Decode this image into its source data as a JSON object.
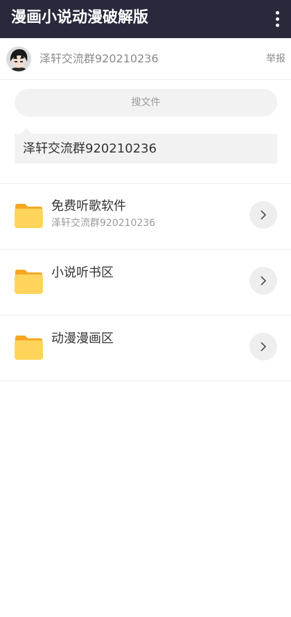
{
  "app_bar": {
    "title": "漫画小说动漫破解版",
    "menu_icon": "more-vert-icon",
    "background": "#282a3c"
  },
  "owner": {
    "name": "泽轩交流群920210236",
    "avatar_icon": "avatar-portrait",
    "report_label": "举报"
  },
  "search": {
    "label": "搜文件"
  },
  "notice": {
    "text": "泽轩交流群920210236"
  },
  "folders": [
    {
      "title": "免费听歌软件",
      "subtitle": "泽轩交流群920210236",
      "icon": "folder-icon",
      "action_icon": "chevron-right-icon"
    },
    {
      "title": "小说听书区",
      "subtitle": "",
      "icon": "folder-icon",
      "action_icon": "chevron-right-icon"
    },
    {
      "title": "动漫漫画区",
      "subtitle": "",
      "icon": "folder-icon",
      "action_icon": "chevron-right-icon"
    }
  ],
  "colors": {
    "folder_front": "#ffd45a",
    "folder_back": "#f5a623",
    "text_secondary": "#8a8a8a"
  }
}
